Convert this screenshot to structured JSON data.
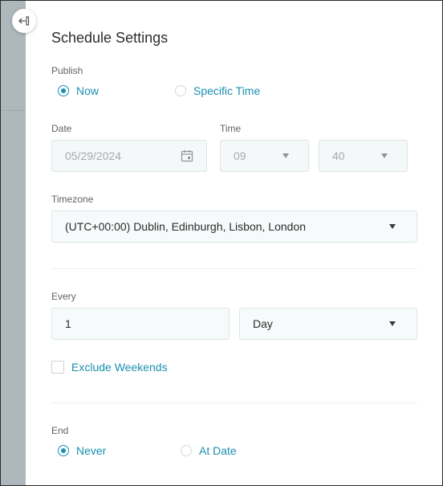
{
  "panel": {
    "title": "Schedule Settings"
  },
  "publish": {
    "label": "Publish",
    "options": [
      {
        "label": "Now",
        "selected": true
      },
      {
        "label": "Specific Time",
        "selected": false
      }
    ]
  },
  "date": {
    "label": "Date",
    "value": "05/29/2024",
    "icon": "calendar-icon"
  },
  "time": {
    "label": "Time",
    "hour": "09",
    "minute": "40"
  },
  "timezone": {
    "label": "Timezone",
    "value": "(UTC+00:00) Dublin, Edinburgh, Lisbon, London"
  },
  "every": {
    "label": "Every",
    "value": "1",
    "unit": "Day"
  },
  "exclude_weekends": {
    "label": "Exclude Weekends",
    "checked": false
  },
  "end": {
    "label": "End",
    "options": [
      {
        "label": "Never",
        "selected": true
      },
      {
        "label": "At Date",
        "selected": false
      }
    ]
  },
  "colors": {
    "accent": "#1a8fb0",
    "backdrop": "#aeb8bc",
    "field_bg": "#f7fafb",
    "field_border": "#dde5e8"
  }
}
